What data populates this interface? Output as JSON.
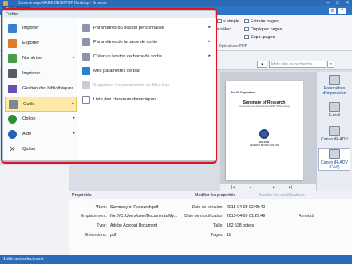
{
  "window": {
    "title": "Canon imageWARE DESKTOP Desktop - Browser",
    "minimize": "—",
    "maximize": "□",
    "close": "✕"
  },
  "ribbon": {
    "tab_fichier": "Fichier",
    "help": "?",
    "cmds": {
      "simple": "s simple",
      "select": "s sélect.",
      "extraire": "Extraire pages",
      "dupliquer": "Dupliquer pages",
      "supp": "Supp. pages"
    },
    "group_label": "Opérations PDF"
  },
  "search": {
    "placeholder": "Mots clés de recherche",
    "dropdown": "▾",
    "button": "⌕"
  },
  "menu": {
    "header": "Fichier",
    "items": [
      {
        "label": "Importer",
        "icon": "import-icon",
        "color": "#3b7fd1",
        "arrow": ""
      },
      {
        "label": "Exporter",
        "icon": "export-icon",
        "color": "#e07b2a",
        "arrow": ""
      },
      {
        "label": "Numériser",
        "icon": "scan-icon",
        "color": "#4a9c4a",
        "arrow": "▸"
      },
      {
        "label": "Imprimer",
        "icon": "print-icon",
        "color": "#555c66",
        "arrow": ""
      },
      {
        "label": "Gestion des bibliothèques",
        "icon": "library-icon",
        "color": "#6a4fb3",
        "arrow": ""
      },
      {
        "label": "Outils",
        "icon": "tools-icon",
        "color": "#7a8794",
        "arrow": "▸"
      },
      {
        "label": "Option",
        "icon": "option-icon",
        "color": "#2f8f2f",
        "arrow": "▸"
      },
      {
        "label": "Aide",
        "icon": "help-icon",
        "color": "#1f64b8",
        "arrow": "▸"
      },
      {
        "label": "Quitter",
        "icon": "close-icon",
        "color": "#555555",
        "arrow": ""
      }
    ],
    "submenu": [
      {
        "label": "Paramètres du bouton personnalisé",
        "icon": "custom-button-icon",
        "arrow": "▸",
        "disabled": false
      },
      {
        "label": "Paramètres de la barre de sortie",
        "icon": "output-bar-icon",
        "arrow": "▸",
        "disabled": false
      },
      {
        "label": "Créer un bouton de barre de sortie",
        "icon": "create-button-icon",
        "arrow": "▸",
        "disabled": false
      },
      {
        "label": "Mes paramètres de bac",
        "icon": "tray-settings-icon",
        "arrow": "",
        "disabled": false
      },
      {
        "label": "Supprimer les paramètres de Mon bac",
        "icon": "delete-tray-icon",
        "arrow": "",
        "disabled": true
      },
      {
        "label": "Liste des classeurs dynamiques",
        "icon": "binder-list-icon",
        "arrow": "",
        "disabled": false
      }
    ]
  },
  "document": {
    "company": "Pen Oil Corporation",
    "title": "Summary of Research",
    "subtitle": "The Research and Development of PEN Oil Technology",
    "footer1": "2015.01.01",
    "footer2": "RESEARCH BRANCH ANALYSIS"
  },
  "viewer_nav": {
    "first": "|◂",
    "prev": "◂",
    "next": "▸",
    "last": "▸|"
  },
  "printers": [
    {
      "label": "Paramètres d'impression"
    },
    {
      "label": "E-mail"
    },
    {
      "label": "Canon iR-ADV"
    },
    {
      "label": "Canon iR-ADV (FAX)"
    }
  ],
  "properties": {
    "title": "Propriétés",
    "modify_btn": "Modifier les propriétés",
    "cancel_btn": "Annuler les modifications",
    "annot": "Annotati",
    "fields_left": [
      {
        "label": "*Nom:",
        "value": "Summary of Research.pdf"
      },
      {
        "label": "Emplacement:",
        "value": "file:///C:/Users/user/Documents/My..."
      },
      {
        "label": "Type:",
        "value": "Adobe Acrobat Document"
      },
      {
        "label": "Extensions:",
        "value": "pdf"
      }
    ],
    "fields_right": [
      {
        "label": "Date de création:",
        "value": "2015-04-09 02:45:40"
      },
      {
        "label": "Date de modification:",
        "value": "2015-04-09 01:29:49"
      },
      {
        "label": "Taille:",
        "value": "162 538 octets"
      },
      {
        "label": "Pages:",
        "value": "11"
      }
    ]
  },
  "status": {
    "text": "1 élément sélectionné"
  }
}
